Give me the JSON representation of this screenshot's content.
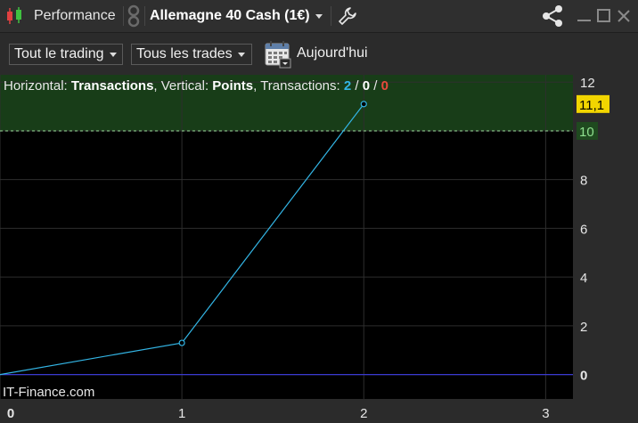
{
  "window": {
    "module_title": "Performance",
    "instrument": "Allemagne 40 Cash (1€)"
  },
  "toolbar": {
    "filter_trading": "Tout le trading",
    "filter_trades": "Tous les trades",
    "date_label": "Aujourd'hui"
  },
  "header": {
    "horizontal_label": "Horizontal:",
    "horizontal_value": "Transactions",
    "vertical_label": ", Vertical:",
    "vertical_value": "Points",
    "transactions_label": ", Transactions:",
    "count_total": "2",
    "count_mid": "0",
    "count_red": "0",
    "slash": " / "
  },
  "chart_data": {
    "type": "line",
    "x": [
      0,
      1,
      2
    ],
    "y": [
      0,
      1.3,
      11.1
    ],
    "xlim": [
      0,
      3.15
    ],
    "ylim": [
      -1,
      12.3
    ],
    "x_ticks": [
      "0",
      "1",
      "2",
      "3"
    ],
    "y_ticks": [
      "0",
      "2",
      "4",
      "6",
      "8",
      "10",
      "12"
    ],
    "target_level": 10,
    "target_label": "10",
    "last_value_label": "11,1",
    "line_color": "#33b5e5",
    "zero_line_color": "#3a3ad0",
    "target_zone_color": "#183d18",
    "grid": true
  },
  "watermark": "IT-Finance.com"
}
